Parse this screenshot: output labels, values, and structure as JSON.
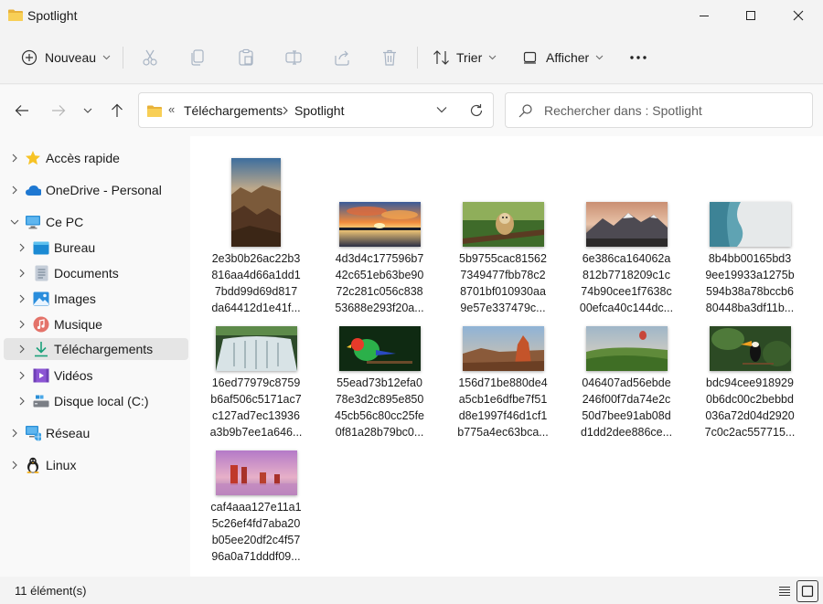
{
  "window": {
    "title": "Spotlight"
  },
  "toolbar": {
    "new_label": "Nouveau",
    "sort_label": "Trier",
    "view_label": "Afficher"
  },
  "address": {
    "overflow": "«",
    "crumbs": [
      "Téléchargements",
      "Spotlight"
    ]
  },
  "search": {
    "placeholder": "Rechercher dans : Spotlight"
  },
  "sidebar": {
    "items": [
      {
        "label": "Accès rapide",
        "icon": "star-icon"
      },
      {
        "label": "OneDrive - Personal",
        "icon": "cloud-icon"
      },
      {
        "label": "Ce PC",
        "icon": "monitor-icon"
      },
      {
        "label": "Bureau",
        "icon": "desktop-icon"
      },
      {
        "label": "Documents",
        "icon": "documents-icon"
      },
      {
        "label": "Images",
        "icon": "images-icon"
      },
      {
        "label": "Musique",
        "icon": "music-icon"
      },
      {
        "label": "Téléchargements",
        "icon": "download-icon"
      },
      {
        "label": "Vidéos",
        "icon": "videos-icon"
      },
      {
        "label": "Disque local (C:)",
        "icon": "drive-icon"
      },
      {
        "label": "Réseau",
        "icon": "network-icon"
      },
      {
        "label": "Linux",
        "icon": "linux-icon"
      }
    ]
  },
  "files": [
    {
      "lines": [
        "2e3b0b26ac22b3",
        "816aa4d66a1dd1",
        "7bdd99d69d817",
        "da64412d1e41f..."
      ]
    },
    {
      "lines": [
        "4d3d4c177596b7",
        "42c651eb63be90",
        "72c281c056c838",
        "53688e293f20a..."
      ]
    },
    {
      "lines": [
        "5b9755cac81562",
        "7349477fbb78c2",
        "8701bf010930aa",
        "9e57e337479c..."
      ]
    },
    {
      "lines": [
        "6e386ca164062a",
        "812b7718209c1c",
        "74b90cee1f7638c",
        "00efca40c144dc..."
      ]
    },
    {
      "lines": [
        "8b4bb00165bd3",
        "9ee19933a1275b",
        "594b38a78bccb6",
        "80448ba3df11b..."
      ]
    },
    {
      "lines": [
        "16ed77979c8759",
        "b6af506c5171ac7",
        "c127ad7ec13936",
        "a3b9b7ee1a646..."
      ]
    },
    {
      "lines": [
        "55ead73b12efa0",
        "78e3d2c895e850",
        "45cb56c80cc25fe",
        "0f81a28b79bc0..."
      ]
    },
    {
      "lines": [
        "156d71be880de4",
        "a5cb1e6dfbe7f51",
        "d8e1997f46d1cf1",
        "b775a4ec63bca..."
      ]
    },
    {
      "lines": [
        "046407ad56ebde",
        "246f00f7da74e2c",
        "50d7bee91ab08d",
        "d1dd2dee886ce..."
      ]
    },
    {
      "lines": [
        "bdc94cee918929",
        "0b6dc00c2bebbd",
        "036a72d04d2920",
        "7c0c2ac557715..."
      ]
    },
    {
      "lines": [
        "caf4aaa127e11a1",
        "5c26ef4fd7aba20",
        "b05ee20df2c4f57",
        "96a0a71dddf09..."
      ]
    }
  ],
  "status": {
    "count": "11 élément(s)"
  }
}
